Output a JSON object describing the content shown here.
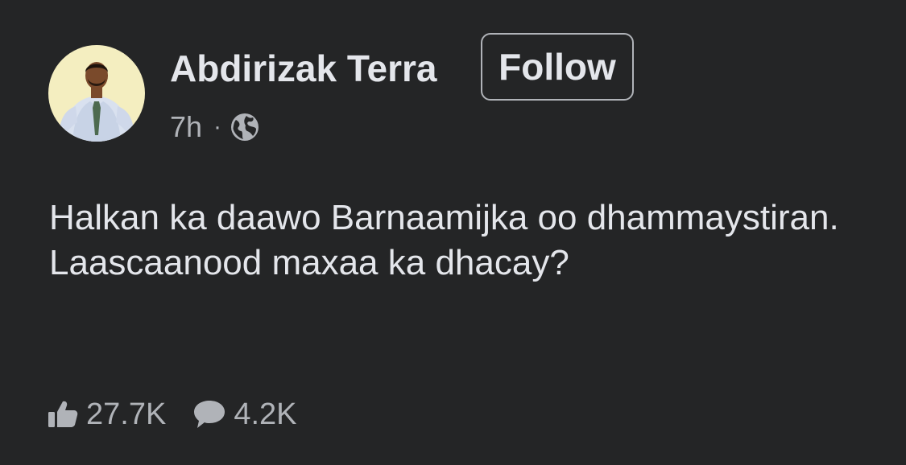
{
  "post": {
    "author": {
      "name": "Abdirizak Terra",
      "avatar": "profile-photo"
    },
    "follow_label": "Follow",
    "time": "7h",
    "separator": "·",
    "audience_icon": "globe-icon",
    "text": "Halkan ka daawo Barnaamijka oo dhammaystiran. Laascaanood maxaa ka dhacay?",
    "reactions": {
      "likes": "27.7K",
      "like_icon": "thumbs-up-icon",
      "comments": "4.2K",
      "comment_icon": "comment-bubble-icon"
    }
  },
  "colors": {
    "background": "#242526",
    "primary_text": "#e4e6eb",
    "secondary_text": "#b0b3b8",
    "avatar_background": "#f4eec0"
  }
}
